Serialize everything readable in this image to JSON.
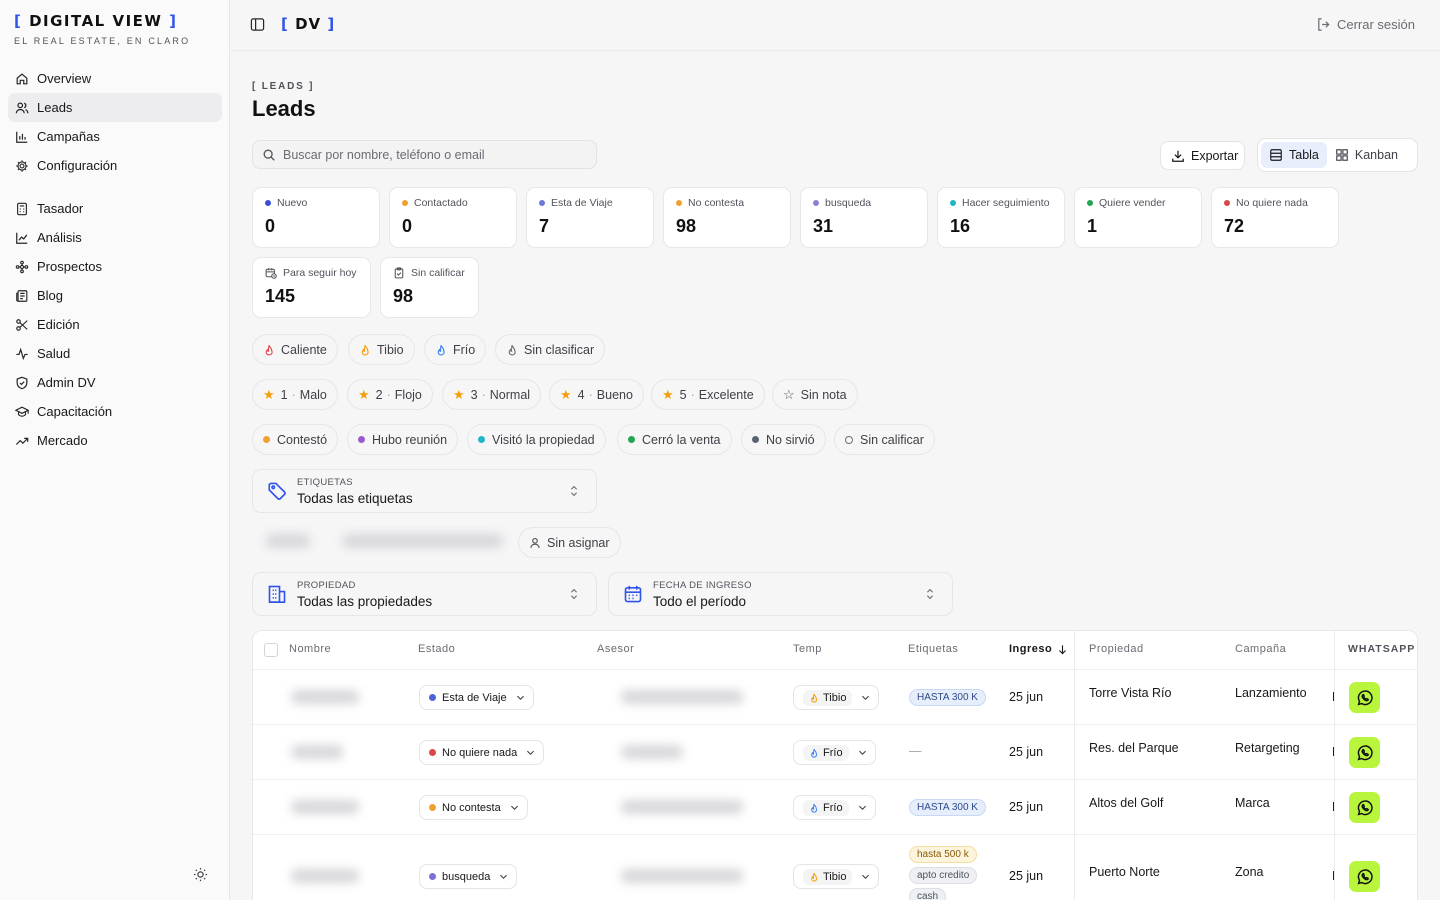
{
  "brand": {
    "title_open": "[",
    "title_text": " DIGITAL VIEW ",
    "title_close": "]",
    "tagline": "EL REAL ESTATE, EN CLARO",
    "short_open": "[",
    "short_text": " DV ",
    "short_close": "]"
  },
  "header": {
    "logout": "Cerrar sesión"
  },
  "sidebar": {
    "group1": [
      {
        "label": "Overview",
        "icon": "home-icon"
      },
      {
        "label": "Leads",
        "icon": "users-icon",
        "active": true
      },
      {
        "label": "Campañas",
        "icon": "bar-chart-icon"
      },
      {
        "label": "Configuración",
        "icon": "gear-icon"
      }
    ],
    "group2": [
      {
        "label": "Tasador",
        "icon": "calculator-icon"
      },
      {
        "label": "Análisis",
        "icon": "line-chart-icon"
      },
      {
        "label": "Prospectos",
        "icon": "sparkle-icon"
      },
      {
        "label": "Blog",
        "icon": "newspaper-icon"
      },
      {
        "label": "Edición",
        "icon": "scissors-icon"
      },
      {
        "label": "Salud",
        "icon": "activity-icon"
      },
      {
        "label": "Admin DV",
        "icon": "shield-icon"
      },
      {
        "label": "Capacitación",
        "icon": "graduation-cap-icon"
      },
      {
        "label": "Mercado",
        "icon": "trending-up-icon"
      }
    ]
  },
  "page": {
    "eyebrow": "[ LEADS ]",
    "title": "Leads"
  },
  "search": {
    "placeholder": "Buscar por nombre, teléfono o email",
    "value": ""
  },
  "toolbar": {
    "export": "Exportar",
    "view_table": "Tabla",
    "view_kanban": "Kanban"
  },
  "stats": [
    {
      "label": "Nuevo",
      "value": "0",
      "color": "#3b4fd8"
    },
    {
      "label": "Contactado",
      "value": "0",
      "color": "#f0a030"
    },
    {
      "label": "Esta de Viaje",
      "value": "7",
      "color": "#6b7ad8"
    },
    {
      "label": "No contesta",
      "value": "98",
      "color": "#f0a030"
    },
    {
      "label": "busqueda",
      "value": "31",
      "color": "#8b7fd8"
    },
    {
      "label": "Hacer seguimiento",
      "value": "16",
      "color": "#22b5c8"
    },
    {
      "label": "Quiere vender",
      "value": "1",
      "color": "#22a552"
    },
    {
      "label": "No quiere nada",
      "value": "72",
      "color": "#d94848"
    }
  ],
  "stats2": [
    {
      "label": "Para seguir hoy",
      "value": "145",
      "icon": "calendar-clock-icon"
    },
    {
      "label": "Sin calificar",
      "value": "98",
      "icon": "clipboard-icon"
    }
  ],
  "temp_filters": [
    {
      "label": "Caliente",
      "color": "#e5484d"
    },
    {
      "label": "Tibio",
      "color": "#f59e0b"
    },
    {
      "label": "Frío",
      "color": "#3b82f6"
    },
    {
      "label": "Sin clasificar",
      "color": "#71717a"
    }
  ],
  "rating_filters": [
    {
      "num": "1",
      "label": "Malo"
    },
    {
      "num": "2",
      "label": "Flojo"
    },
    {
      "num": "3",
      "label": "Normal"
    },
    {
      "num": "4",
      "label": "Bueno"
    },
    {
      "num": "5",
      "label": "Excelente"
    }
  ],
  "rating_none": "Sin nota",
  "sep": "·",
  "outcome_filters": [
    {
      "label": "Contestó",
      "color": "#f0a030"
    },
    {
      "label": "Hubo reunión",
      "color": "#9b59d0"
    },
    {
      "label": "Visitó la propiedad",
      "color": "#22b5c8"
    },
    {
      "label": "Cerró la venta",
      "color": "#22a552"
    },
    {
      "label": "No sirvió",
      "color": "#5b6270"
    }
  ],
  "outcome_none": "Sin calificar",
  "tags_select": {
    "label": "ETIQUETAS",
    "value": "Todas las etiquetas"
  },
  "unassigned": "Sin asignar",
  "property_select": {
    "label": "PROPIEDAD",
    "value": "Todas las propiedades"
  },
  "date_select": {
    "label": "FECHA DE INGRESO",
    "value": "Todo el período"
  },
  "table": {
    "headers": {
      "name": "Nombre",
      "status": "Estado",
      "agent": "Asesor",
      "temp": "Temp",
      "tags": "Etiquetas",
      "date": "Ingreso",
      "property": "Propiedad",
      "campaign": "Campaña",
      "whatsapp": "WHATSAPP"
    },
    "rows": [
      {
        "status": "Esta de Viaje",
        "status_color": "#4f63d8",
        "temp": "Tibio",
        "tags": [
          "HASTA 300 K"
        ],
        "date": "25 jun",
        "property": "Torre Vista Río",
        "campaign": "Lanzamiento",
        "cut": "E"
      },
      {
        "status": "No quiere nada",
        "status_color": "#d94848",
        "temp": "Frío",
        "tags": [],
        "tags_empty": "—",
        "date": "25 jun",
        "property": "Res. del Parque",
        "campaign": "Retargeting",
        "cut": "E"
      },
      {
        "status": "No contesta",
        "status_color": "#f0a030",
        "temp": "Frío",
        "tags": [
          "HASTA 300 K"
        ],
        "date": "25 jun",
        "property": "Altos del Golf",
        "campaign": "Marca",
        "cut": "E"
      },
      {
        "status": "busqueda",
        "status_color": "#7b6fd8",
        "temp": "Tibio",
        "tags": [
          "hasta 500 k",
          "apto credito",
          "cash"
        ],
        "date": "25 jun",
        "property": "Puerto Norte",
        "campaign": "Zona",
        "cut": "E"
      }
    ]
  }
}
